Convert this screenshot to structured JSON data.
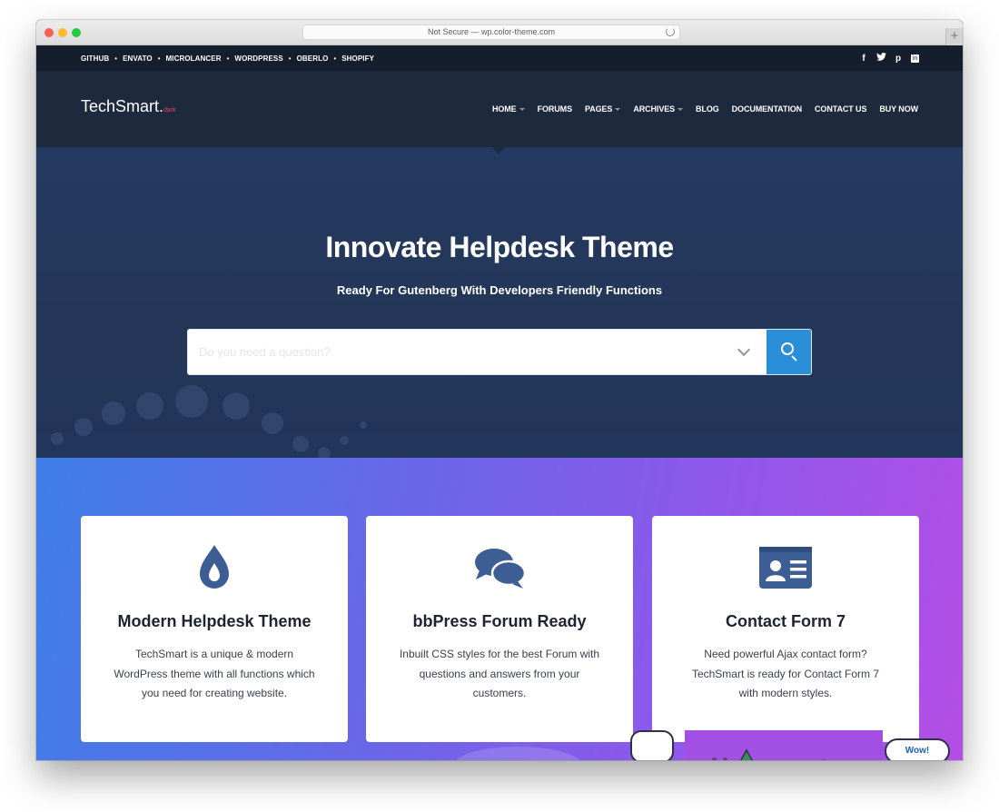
{
  "browser": {
    "url_text": "Not Secure — wp.color-theme.com",
    "newtab_label": "+"
  },
  "topbar": {
    "links": [
      "GITHUB",
      "ENVATO",
      "MICROLANCER",
      "WORDPRESS",
      "OBERLO",
      "SHOPIFY"
    ],
    "separator": "•",
    "social": {
      "facebook": "f",
      "twitter": "t",
      "pinterest": "p",
      "linkedin": "in"
    }
  },
  "header": {
    "logo_main": "TechSmart.",
    "logo_suffix": "dark",
    "nav": [
      "HOME",
      "FORUMS",
      "PAGES",
      "ARCHIVES",
      "BLOG",
      "DOCUMENTATION",
      "CONTACT US",
      "BUY NOW"
    ]
  },
  "hero": {
    "title": "Innovate Helpdesk Theme",
    "subtitle": "Ready For Gutenberg With Developers Friendly Functions",
    "search_placeholder": "Do you need a question?"
  },
  "features": [
    {
      "icon": "water-drop-icon",
      "title": "Modern Helpdesk Theme",
      "text": "TechSmart is a unique & modern WordPress theme with all functions which you need for creating website."
    },
    {
      "icon": "chat-bubbles-icon",
      "title": "bbPress Forum Ready",
      "text": "Inbuilt CSS styles for the best Forum with questions and answers from your customers."
    },
    {
      "icon": "contact-card-icon",
      "title": "Contact Form 7",
      "text": "Need powerful Ajax contact form? TechSmart is ready for Contact Form 7 with modern styles."
    }
  ],
  "decor": {
    "wow_label": "Wow!"
  },
  "colors": {
    "topbar_bg": "#151e2c",
    "header_bg": "#1d2a3d",
    "hero_bg": "#243858",
    "search_button": "#2a8fd8",
    "icon_blue": "#3d5e95",
    "logo_accent": "#e8435a",
    "gradient_start": "#3f7fe7",
    "gradient_end": "#b34ee6"
  }
}
